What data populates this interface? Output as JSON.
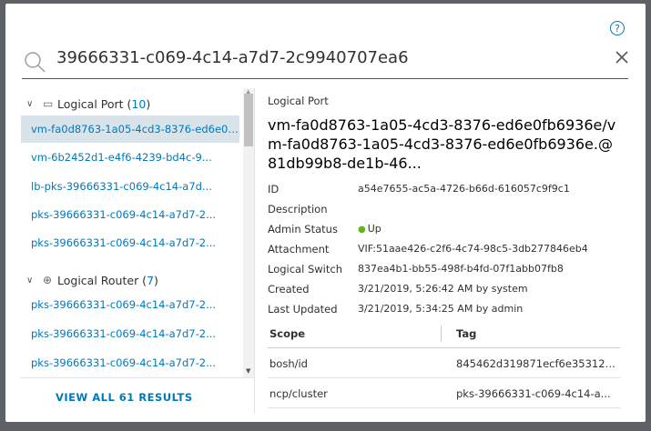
{
  "search": {
    "query": "39666331-c069-4c14-a7d7-2c9940707ea6"
  },
  "results": {
    "groups": [
      {
        "label": "Logical Port",
        "count": "10",
        "items": [
          "vm-fa0d8763-1a05-4cd3-8376-ed6e0fb6936e",
          "vm-6b2452d1-e4f6-4239-bd4c-9...",
          "lb-pks-39666331-c069-4c14-a7d...",
          "pks-39666331-c069-4c14-a7d7-2...",
          "pks-39666331-c069-4c14-a7d7-2..."
        ]
      },
      {
        "label": "Logical Router",
        "count": "7",
        "items": [
          "pks-39666331-c069-4c14-a7d7-2...",
          "pks-39666331-c069-4c14-a7d7-2...",
          "pks-39666331-c069-4c14-a7d7-2..."
        ]
      }
    ],
    "view_all_label": "VIEW ALL 61 RESULTS"
  },
  "detail": {
    "type": "Logical Port",
    "title": "vm-fa0d8763-1a05-4cd3-8376-ed6e0fb6936e/vm-fa0d8763-1a05-4cd3-8376-ed6e0fb6936e.@81db99b8-de1b-46...",
    "properties": [
      {
        "key": "ID",
        "value": "a54e7655-ac5a-4726-b66d-616057c9f9c1"
      },
      {
        "key": "Description",
        "value": ""
      },
      {
        "key": "Admin Status",
        "value": "Up"
      },
      {
        "key": "Attachment",
        "value": "VIF:51aae426-c2f6-4c74-98c5-3db277846eb4"
      },
      {
        "key": "Logical Switch",
        "value": "837ea4b1-bb55-498f-b4fd-07f1abb07fb8"
      },
      {
        "key": "Created",
        "value": "3/21/2019, 5:26:42 AM by system"
      },
      {
        "key": "Last Updated",
        "value": "3/21/2019, 5:34:25 AM by admin"
      }
    ],
    "tags_table": {
      "headers": [
        "Scope",
        "Tag"
      ],
      "rows": [
        [
          "bosh/id",
          "845462d319871ecf6e353121..."
        ],
        [
          "ncp/cluster",
          "pks-39666331-c069-4c14-a..."
        ]
      ]
    }
  },
  "colors": {
    "link": "#0079b8",
    "selected_bg": "#d8e3ea",
    "status_up": "#5eb715",
    "backdrop": "#5e6266"
  },
  "icons": {
    "help": "help-circle-icon",
    "search": "search-icon",
    "close": "close-icon",
    "logical_port": "port-icon",
    "logical_router": "router-icon"
  }
}
